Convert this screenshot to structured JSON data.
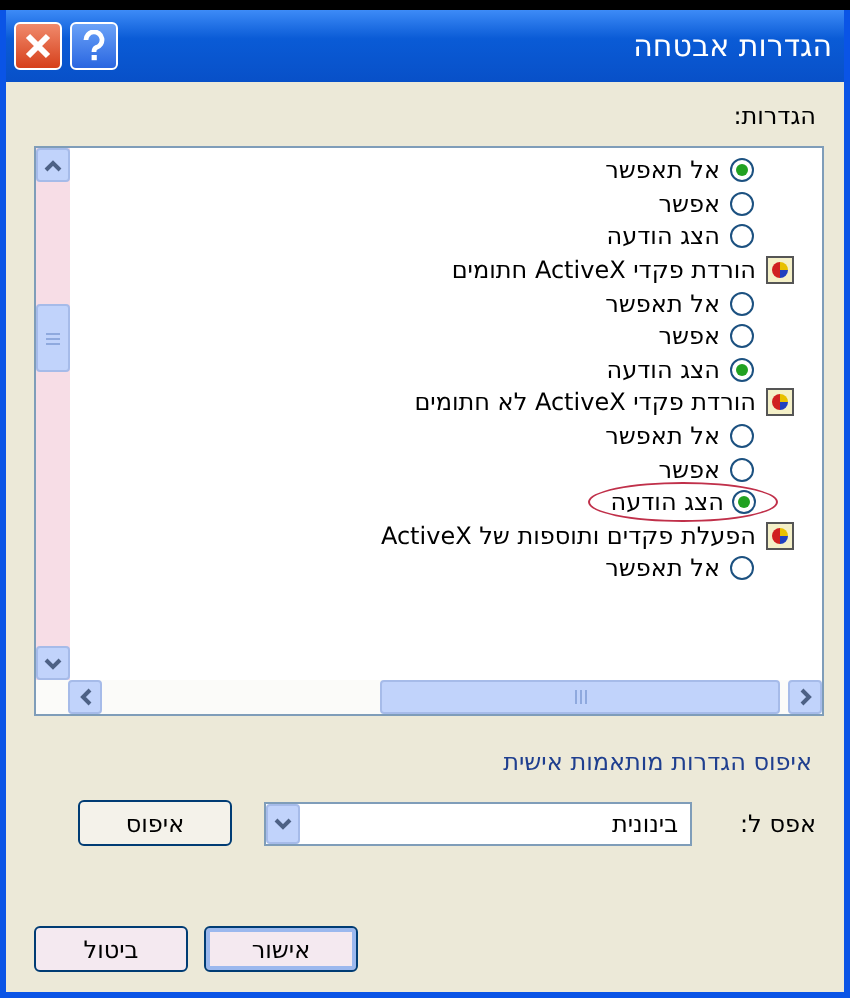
{
  "window": {
    "title": "הגדרות אבטחה"
  },
  "settings": {
    "label": "הגדרות:",
    "items": [
      {
        "kind": "radio",
        "label": "אל תאפשר",
        "selected": true,
        "highlighted": false
      },
      {
        "kind": "radio",
        "label": "אפשר",
        "selected": false,
        "highlighted": false
      },
      {
        "kind": "radio",
        "label": "הצג הודעה",
        "selected": false,
        "highlighted": false
      },
      {
        "kind": "category",
        "label": "הורדת פקדי ActiveX חתומים"
      },
      {
        "kind": "radio",
        "label": "אל תאפשר",
        "selected": false,
        "highlighted": false
      },
      {
        "kind": "radio",
        "label": "אפשר",
        "selected": false,
        "highlighted": false
      },
      {
        "kind": "radio",
        "label": "הצג הודעה",
        "selected": true,
        "highlighted": false
      },
      {
        "kind": "category",
        "label": "הורדת פקדי ActiveX לא חתומים"
      },
      {
        "kind": "radio",
        "label": "אל תאפשר",
        "selected": false,
        "highlighted": false
      },
      {
        "kind": "radio",
        "label": "אפשר",
        "selected": false,
        "highlighted": false
      },
      {
        "kind": "radio",
        "label": "הצג הודעה",
        "selected": true,
        "highlighted": true
      },
      {
        "kind": "category",
        "label": "הפעלת פקדים ותוספות של ActiveX"
      },
      {
        "kind": "radio",
        "label": "אל תאפשר",
        "selected": false,
        "highlighted": false
      }
    ]
  },
  "reset": {
    "title": "איפוס הגדרות מותאמות אישית",
    "label": "אפס ל:",
    "value": "בינונית",
    "button": "איפוס"
  },
  "buttons": [
    {
      "label": "אישור",
      "default": true
    },
    {
      "label": "ביטול",
      "default": false
    }
  ]
}
